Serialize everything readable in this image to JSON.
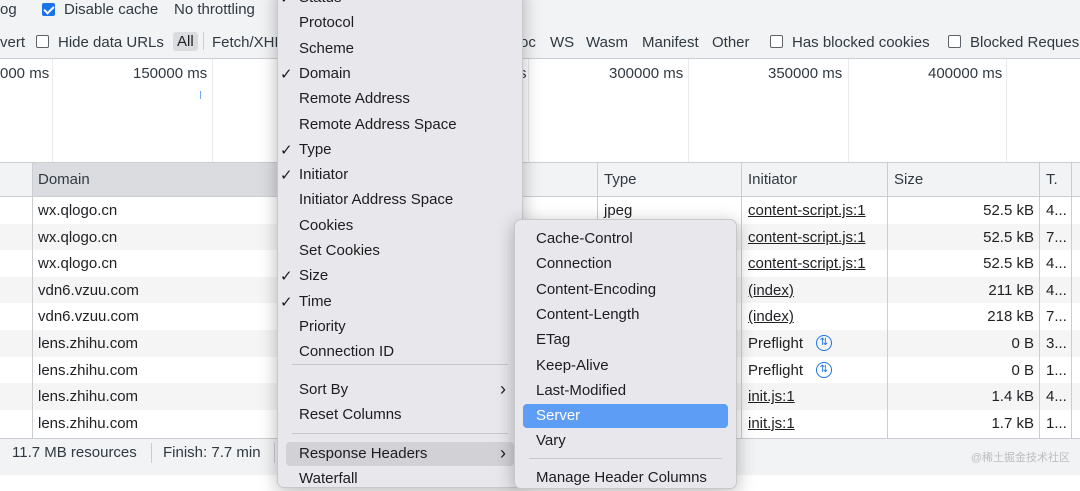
{
  "toolbar": {
    "log_label": "og",
    "disable_cache_label": "Disable cache",
    "throttling_label": "No throttling",
    "invert_label": "vert",
    "hide_data_urls_label": "Hide data URLs",
    "filters": [
      "All",
      "Fetch/XHR",
      "oc",
      "WS",
      "Wasm",
      "Manifest",
      "Other"
    ],
    "blocked_cookies_label": "Has blocked cookies",
    "blocked_requests_label": "Blocked Reques"
  },
  "overview": {
    "ticks": [
      "000 ms",
      "150000 ms",
      "s",
      "300000 ms",
      "350000 ms",
      "400000 ms"
    ]
  },
  "table": {
    "headers": {
      "domain": "Domain",
      "type": "Type",
      "initiator": "Initiator",
      "size": "Size",
      "time": "T."
    },
    "rows": [
      {
        "domain": "wx.qlogo.cn",
        "type": "jpeg",
        "initiator": "content-script.js:1",
        "size": "52.5 kB",
        "time": "4..."
      },
      {
        "domain": "wx.qlogo.cn",
        "type": "",
        "initiator": "content-script.js:1",
        "size": "52.5 kB",
        "time": "7..."
      },
      {
        "domain": "wx.qlogo.cn",
        "type": "",
        "initiator": "content-script.js:1",
        "size": "52.5 kB",
        "time": "4..."
      },
      {
        "domain": "vdn6.vzuu.com",
        "type": "",
        "initiator": "(index)",
        "size": "211 kB",
        "time": "4..."
      },
      {
        "domain": "vdn6.vzuu.com",
        "type": "",
        "initiator": "(index)",
        "size": "218 kB",
        "time": "7..."
      },
      {
        "domain": "lens.zhihu.com",
        "type": "",
        "initiator": "Preflight",
        "size": "0 B",
        "time": "3..."
      },
      {
        "domain": "lens.zhihu.com",
        "type": "",
        "initiator": "Preflight",
        "size": "0 B",
        "time": "1..."
      },
      {
        "domain": "lens.zhihu.com",
        "type": "",
        "initiator": "init.js:1",
        "size": "1.4 kB",
        "time": "4..."
      },
      {
        "domain": "lens.zhihu.com",
        "type": "",
        "initiator": "init.js:1",
        "size": "1.7 kB",
        "time": "1..."
      }
    ]
  },
  "status": {
    "resources": "11.7 MB resources",
    "finish": "Finish: 7.7 min"
  },
  "watermark": "@稀土掘金技术社区",
  "context_menu": {
    "items": [
      {
        "label": "Status",
        "checked": true
      },
      {
        "label": "Protocol",
        "checked": false
      },
      {
        "label": "Scheme",
        "checked": false
      },
      {
        "label": "Domain",
        "checked": true
      },
      {
        "label": "Remote Address",
        "checked": false
      },
      {
        "label": "Remote Address Space",
        "checked": false
      },
      {
        "label": "Type",
        "checked": true
      },
      {
        "label": "Initiator",
        "checked": true
      },
      {
        "label": "Initiator Address Space",
        "checked": false
      },
      {
        "label": "Cookies",
        "checked": false
      },
      {
        "label": "Set Cookies",
        "checked": false
      },
      {
        "label": "Size",
        "checked": true
      },
      {
        "label": "Time",
        "checked": true
      },
      {
        "label": "Priority",
        "checked": false
      },
      {
        "label": "Connection ID",
        "checked": false
      }
    ],
    "sort_by": "Sort By",
    "reset_columns": "Reset Columns",
    "response_headers": "Response Headers",
    "waterfall": "Waterfall"
  },
  "submenu": {
    "items": [
      "Cache-Control",
      "Connection",
      "Content-Encoding",
      "Content-Length",
      "ETag",
      "Keep-Alive",
      "Last-Modified",
      "Server",
      "Vary"
    ],
    "highlighted": "Server",
    "manage": "Manage Header Columns"
  },
  "colors": {
    "highlight": "#5e9df6",
    "accent": "#1a73e8"
  },
  "icons": {
    "check": "checkmark-icon",
    "arrow": "chevron-right-icon",
    "preflight": "preflight-icon"
  }
}
